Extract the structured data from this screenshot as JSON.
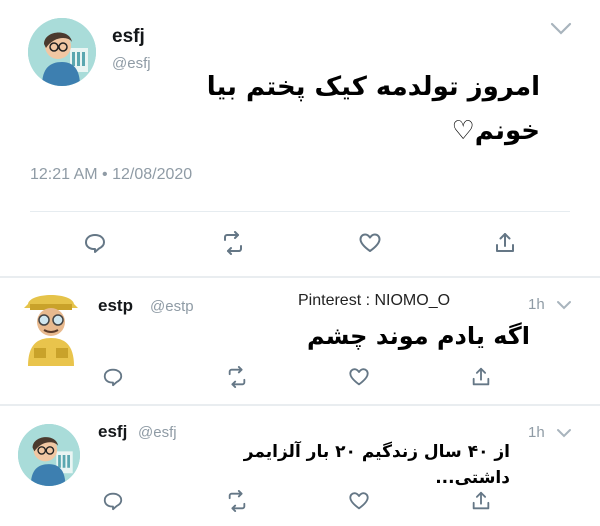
{
  "tweets": [
    {
      "name": "esfj",
      "handle": "@esfj",
      "text_line1": "امروز تولدمه کیک پختم بیا",
      "text_line2": "خونم♡",
      "timestamp": "12:21 AM • 12/08/2020",
      "avatar_icon": "girl-with-glasses-avatar"
    },
    {
      "name": "estp",
      "handle": "@estp",
      "time_ago": "1h",
      "text": "اگه یادم موند چشم",
      "avatar_icon": "explorer-avatar"
    },
    {
      "name": "esfj",
      "handle": "@esfj",
      "time_ago": "1h",
      "text_line1": "از ۴۰ سال زندگیم ۲۰ بار آلزایمر",
      "text_line2": "داشتی...",
      "avatar_icon": "girl-with-glasses-avatar"
    }
  ],
  "watermark": "Pinterest : NIOMO_O",
  "icons": [
    "reply-icon",
    "retweet-icon",
    "like-icon",
    "share-icon",
    "chevron-down-icon"
  ],
  "colors": {
    "gray": "#8f9ba5",
    "divider": "#e6ecf0",
    "icon": "#657786"
  }
}
